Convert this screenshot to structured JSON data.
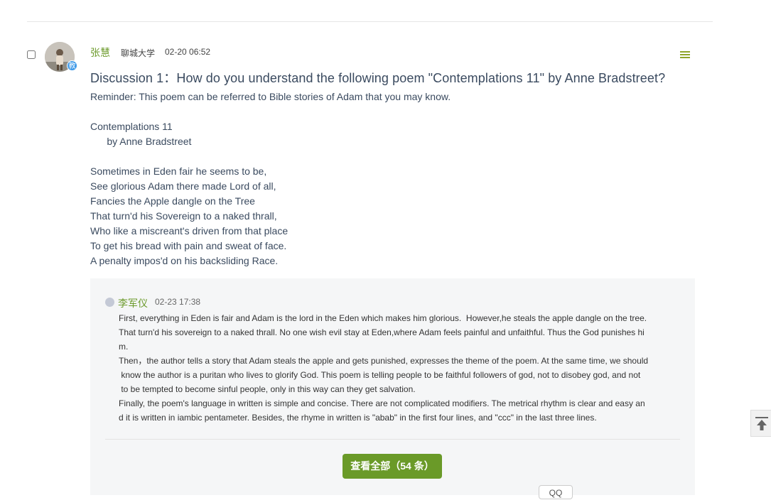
{
  "post": {
    "author": "张慧",
    "school": "聊城大学",
    "time": "02-20 06:52",
    "badge": "教",
    "title": "Discussion 1：How do you understand the following poem \"Contemplations 11\" by Anne Bradstreet?",
    "body_lines": [
      "Reminder: This poem can be referred to Bible stories of Adam that you may know.",
      "",
      "Contemplations 11",
      "      by Anne Bradstreet",
      "",
      "Sometimes in Eden fair he seems to be,",
      "See glorious Adam there made Lord of all,",
      "Fancies the Apple dangle on the Tree",
      "That turn'd his Sovereign to a naked thrall,",
      "Who like a miscreant's driven from that place",
      "To get his bread with pain and sweat of face.",
      "A penalty impos'd on his backsliding Race."
    ]
  },
  "reply": {
    "author": "李军仪",
    "time": "02-23 17:38",
    "body_lines": [
      "First, everything in Eden is fair and Adam is the lord in the Eden which makes him glorious.  However,he steals the apple dangle on the tree.",
      "That turn'd his sovereign to a naked thrall. No one wish evil stay at Eden,where Adam feels painful and unfaithful. Thus the God punishes hi",
      "m.",
      "Then，the author tells a story that Adam steals the apple and gets punished, expresses the theme of the poem. At the same time, we should",
      " know the author is a puritan who lives to glorify God. This poem is telling people to be faithful followers of god, not to disobey god, and not",
      " to be tempted to become sinful people, only in this way can they get salvation.",
      "Finally, the poem's language in written is simple and concise. There are not complicated modifiers. The metrical rhythm is clear and easy an",
      "d it is written in iambic pentameter. Besides, the rhyme in written is \"abab\" in the first four lines, and \"ccc\" in the last three lines."
    ]
  },
  "actions": {
    "view_all_label": "查看全部（54 条）",
    "bottom_chip_label": "QQ"
  },
  "icons": {
    "menu": "hamburger-menu-icon",
    "back_to_top": "back-to-top-icon",
    "accent_color": "#6a9a28"
  }
}
